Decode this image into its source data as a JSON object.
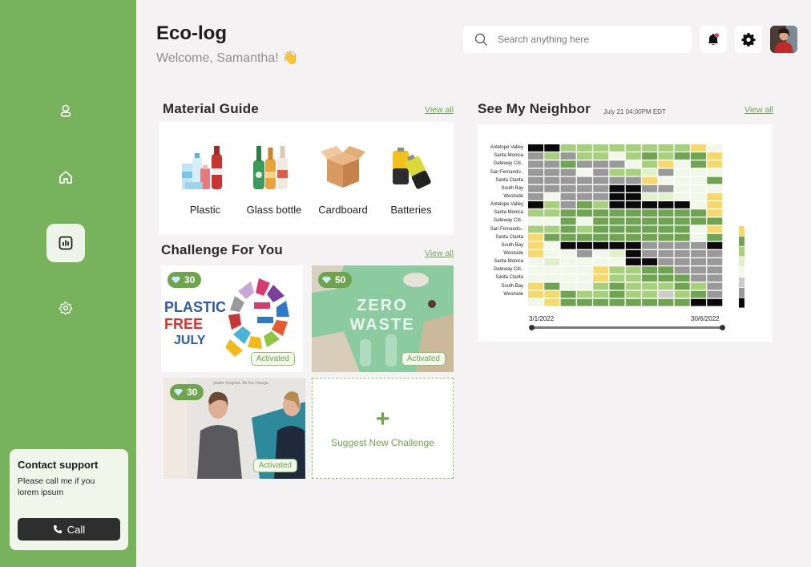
{
  "header": {
    "title": "Eco-log",
    "welcome": "Welcome, Samantha! 👋",
    "search_placeholder": "Search anything here"
  },
  "sidebar": {
    "items": [
      {
        "name": "profile",
        "icon": "user-icon"
      },
      {
        "name": "home",
        "icon": "home-icon"
      },
      {
        "name": "stats",
        "icon": "bar-chart-icon",
        "active": true
      },
      {
        "name": "settings",
        "icon": "gear-icon"
      }
    ],
    "support": {
      "title": "Contact support",
      "text": "Please call me if you lorem ipsum",
      "call_label": "Call"
    }
  },
  "material_guide": {
    "title": "Material Guide",
    "view_all": "View all",
    "items": [
      {
        "label": "Plastic",
        "icon": "plastic-bottles-icon"
      },
      {
        "label": "Glass bottle",
        "icon": "glass-bottles-icon"
      },
      {
        "label": "Cardboard",
        "icon": "cardboard-box-icon"
      },
      {
        "label": "Batteries",
        "icon": "batteries-icon"
      }
    ]
  },
  "challenges": {
    "title": "Challenge For You",
    "view_all": "View all",
    "items": [
      {
        "points": "30",
        "image_text": "PLASTIC FREE JULY",
        "status": "Activated"
      },
      {
        "points": "50",
        "image_text": "ZERO WASTE",
        "status": "Activated"
      },
      {
        "points": "30",
        "image_text": "plastic footprint. Be the change.",
        "status": "Activated"
      }
    ],
    "suggest_label": "Suggest New Challenge",
    "suggest_icon": "+"
  },
  "neighbor": {
    "title": "See My Neighbor",
    "subtitle": "July 21 04:00PM EDT",
    "view_all": "View all",
    "rows": [
      "Antelope Valley",
      "Santa Monica",
      "Gateway Citi..",
      "San Fernando..",
      "Santa Clarita",
      "South Bay",
      "Westside",
      "Antelope Valley",
      "Santa Monica",
      "Gateway Citi..",
      "San Fernando..",
      "Santa Clarita",
      "South Bay",
      "Westside",
      "Santa Monica",
      "Gateway Citi..",
      "Santa Clarita",
      "South Bay",
      "Westside"
    ],
    "start_date": "3/1/2022",
    "end_date": "30/6/2022",
    "colors": {
      "K": "#0a0a0a",
      "G": "#999999",
      "L": "#cccccc",
      "D": "#6fa552",
      "M": "#a6d07c",
      "P": "#dff0cb",
      "W": "#f1f8e9",
      "Y": "#f6d86b"
    },
    "grid": [
      "KKMMMMMMMMYW",
      "GMGMMWMDMDDY",
      "GGDGGGWMYWDY",
      "GGGWGMMPGWWW",
      "GGGGGGGYWWWD",
      "GGGGGKKGGWWW",
      "GWGGGKKPPWWY",
      "KMGDMKKKKKWY",
      "MMDDDDDDDDDY",
      "WWDWDDDDDDDD",
      "MMDMDDDDDDWY",
      "YDDDDDDDDDWD",
      "YWKKKKKGGGGK",
      "YWWGWPKGGGGG",
      "WPWWWWKKGGGG",
      "WWWWYMMDDGGG",
      "WWWWYMMDDDGG",
      "YDWWMDMMMDMG",
      "YYDMMDMMLMDG",
      "WYDDDDDDDDKK"
    ],
    "legend": [
      "Y",
      "D",
      "M",
      "P",
      "W",
      "L",
      "G",
      "K"
    ]
  }
}
